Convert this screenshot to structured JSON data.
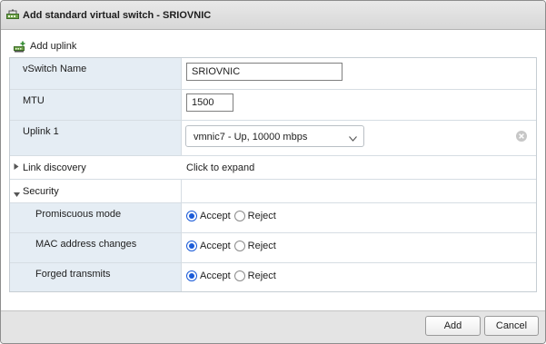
{
  "dialog": {
    "title": "Add standard virtual switch - SRIOVNIC"
  },
  "toolbar": {
    "add_uplink_label": "Add uplink"
  },
  "form": {
    "vswitch_name": {
      "label": "vSwitch Name",
      "value": "SRIOVNIC"
    },
    "mtu": {
      "label": "MTU",
      "value": "1500"
    },
    "uplink1": {
      "label": "Uplink 1",
      "selected": "vmnic7 - Up, 10000 mbps"
    },
    "link_discovery": {
      "label": "Link discovery",
      "value": "Click to expand",
      "expanded": false
    },
    "security": {
      "label": "Security",
      "expanded": true,
      "promiscuous_mode": {
        "label": "Promiscuous mode",
        "selected": "Accept"
      },
      "mac_address_changes": {
        "label": "MAC address changes",
        "selected": "Accept"
      },
      "forged_transmits": {
        "label": "Forged transmits",
        "selected": "Accept"
      },
      "accept_label": "Accept",
      "reject_label": "Reject"
    }
  },
  "footer": {
    "add_label": "Add",
    "cancel_label": "Cancel"
  },
  "icons": {
    "title": "network-switch-icon",
    "add_uplink": "add-uplink-icon",
    "dropdown": "chevron-down-icon",
    "clear": "clear-circle-icon"
  },
  "colors": {
    "label_background": "#e5edf4",
    "radio_accent": "#1a5bd8",
    "title_bar": "#dcdcdc",
    "footer": "#e4e4e4"
  }
}
